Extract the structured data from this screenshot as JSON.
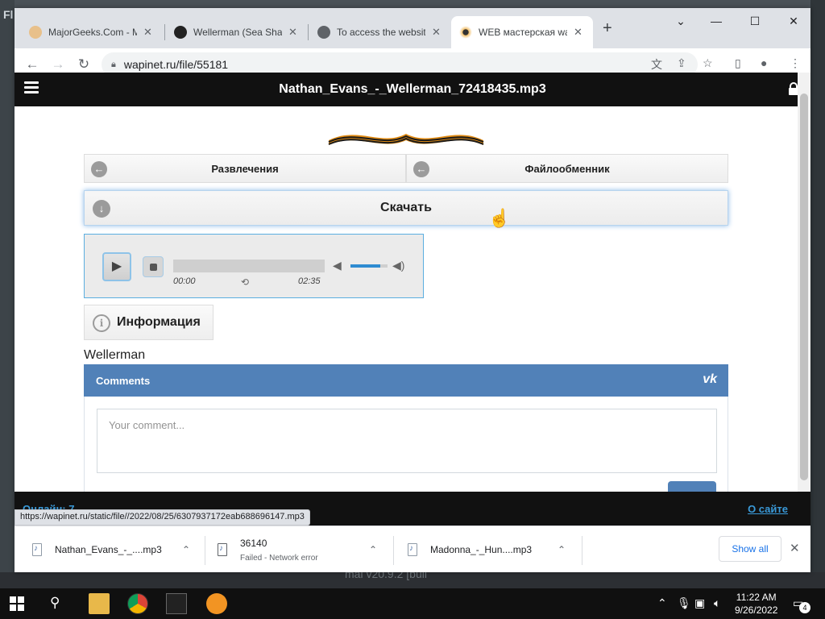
{
  "background": {
    "app_label": "Fl",
    "bottom_text": "mal v20.9.2 [buil"
  },
  "tabs": [
    {
      "title": "MajorGeeks.Com - M",
      "active": false
    },
    {
      "title": "Wellerman (Sea Shan",
      "active": false
    },
    {
      "title": "To access the website",
      "active": false
    },
    {
      "title": "WEB мастерская wa",
      "active": true
    }
  ],
  "address": {
    "url": "wapinet.ru/file/55181"
  },
  "site": {
    "title": "Nathan_Evans_-_Wellerman_72418435.mp3",
    "crumbs": [
      "Развлечения",
      "Файлообменник"
    ],
    "download_label": "Скачать",
    "player": {
      "current_time": "00:00",
      "duration": "02:35",
      "progress": 0,
      "volume": 0.8
    },
    "info_label": "Информация",
    "description": "Wellerman",
    "comments": {
      "title": "Comments",
      "brand": "vk",
      "placeholder": "Your comment..."
    },
    "footer": {
      "online": "Онлайн: 7",
      "about": "О сайте"
    }
  },
  "status_url": "https://wapinet.ru/static/file//2022/08/25/6307937172eab688696147.mp3",
  "downloads": [
    {
      "name": "Nathan_Evans_-_....mp3",
      "status": ""
    },
    {
      "name": "36140",
      "status": "Failed - Network error"
    },
    {
      "name": "Madonna_-_Hun....mp3",
      "status": ""
    }
  ],
  "downloads_show_all": "Show all",
  "taskbar": {
    "time": "11:22 AM",
    "date": "9/26/2022",
    "notifications": "4"
  },
  "colors": {
    "vk_blue": "#5181b8",
    "accent": "#1a73e8",
    "link": "#3a9ad9"
  }
}
